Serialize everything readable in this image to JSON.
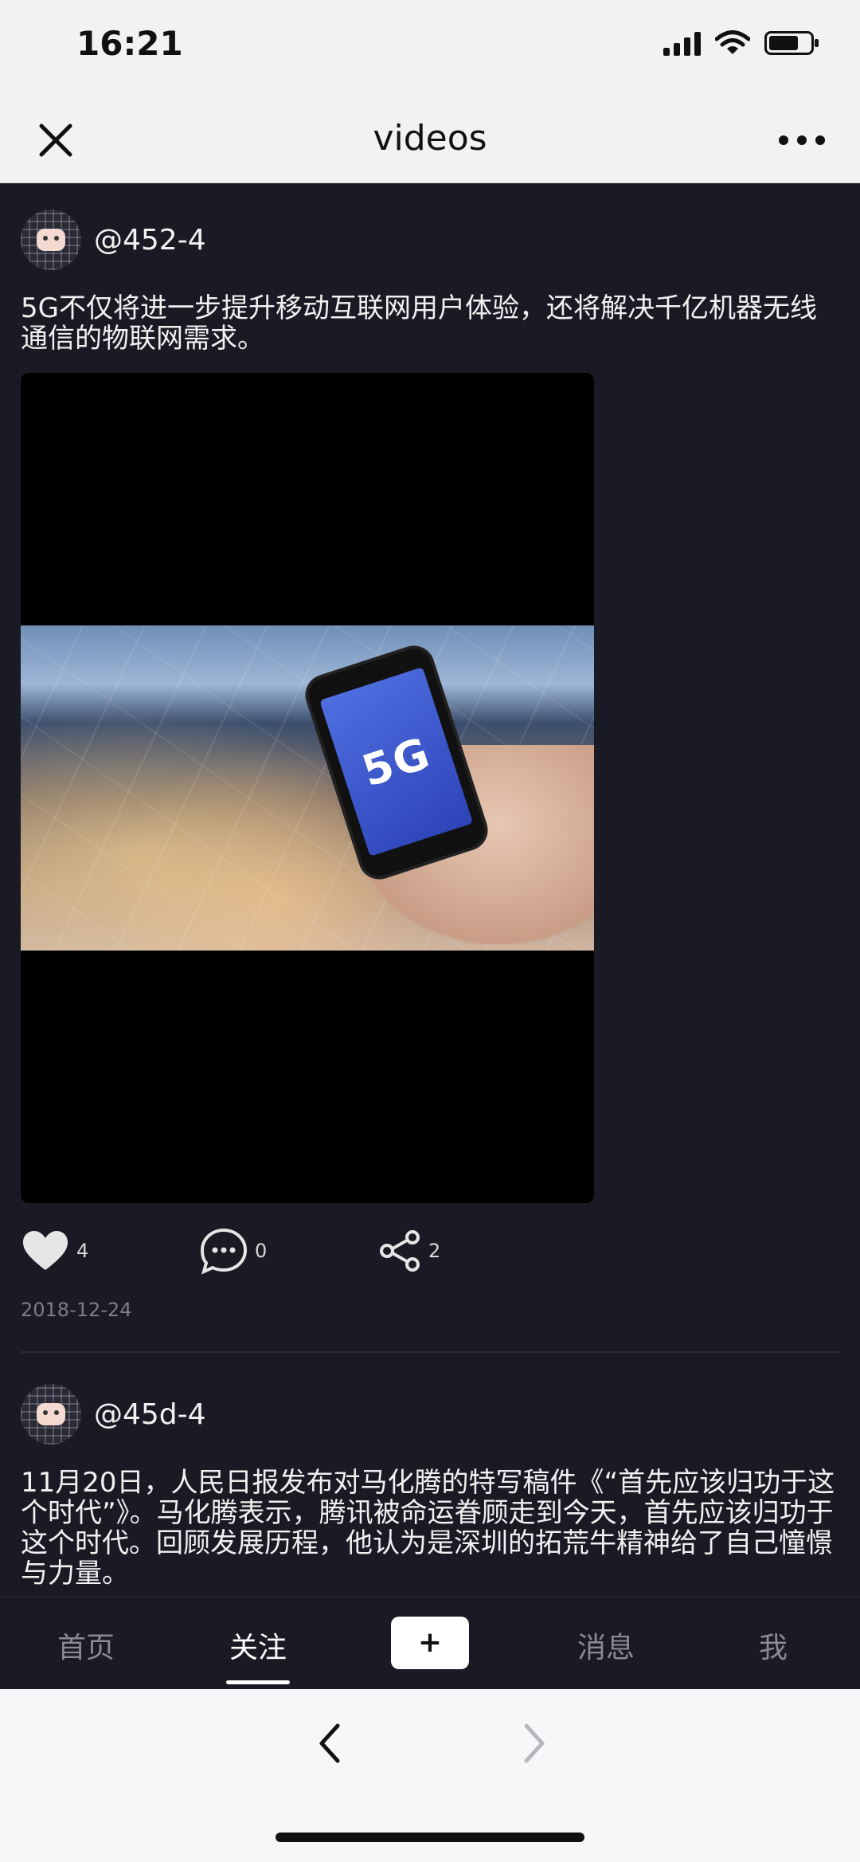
{
  "status_bar": {
    "time": "16:21"
  },
  "nav": {
    "title": "videos"
  },
  "posts": [
    {
      "username": "@452-4",
      "text": "5G不仅将进一步提升移动互联网用户体验，还将解决千亿机器无线通信的物联网需求。",
      "video_overlay_text": "5G",
      "likes": "4",
      "comments": "0",
      "shares": "2",
      "date": "2018-12-24"
    },
    {
      "username": "@45d-4",
      "text": "11月20日，人民日报发布对马化腾的特写稿件《“首先应该归功于这个时代”》。马化腾表示，腾讯被命运眷顾走到今天，首先应该归功于这个时代。回顾发展历程，他认为是深圳的拓荒牛精神给了自己憧憬与力量。"
    }
  ],
  "tab_bar": {
    "home": "首页",
    "following": "关注",
    "add": "+",
    "messages": "消息",
    "me": "我"
  }
}
